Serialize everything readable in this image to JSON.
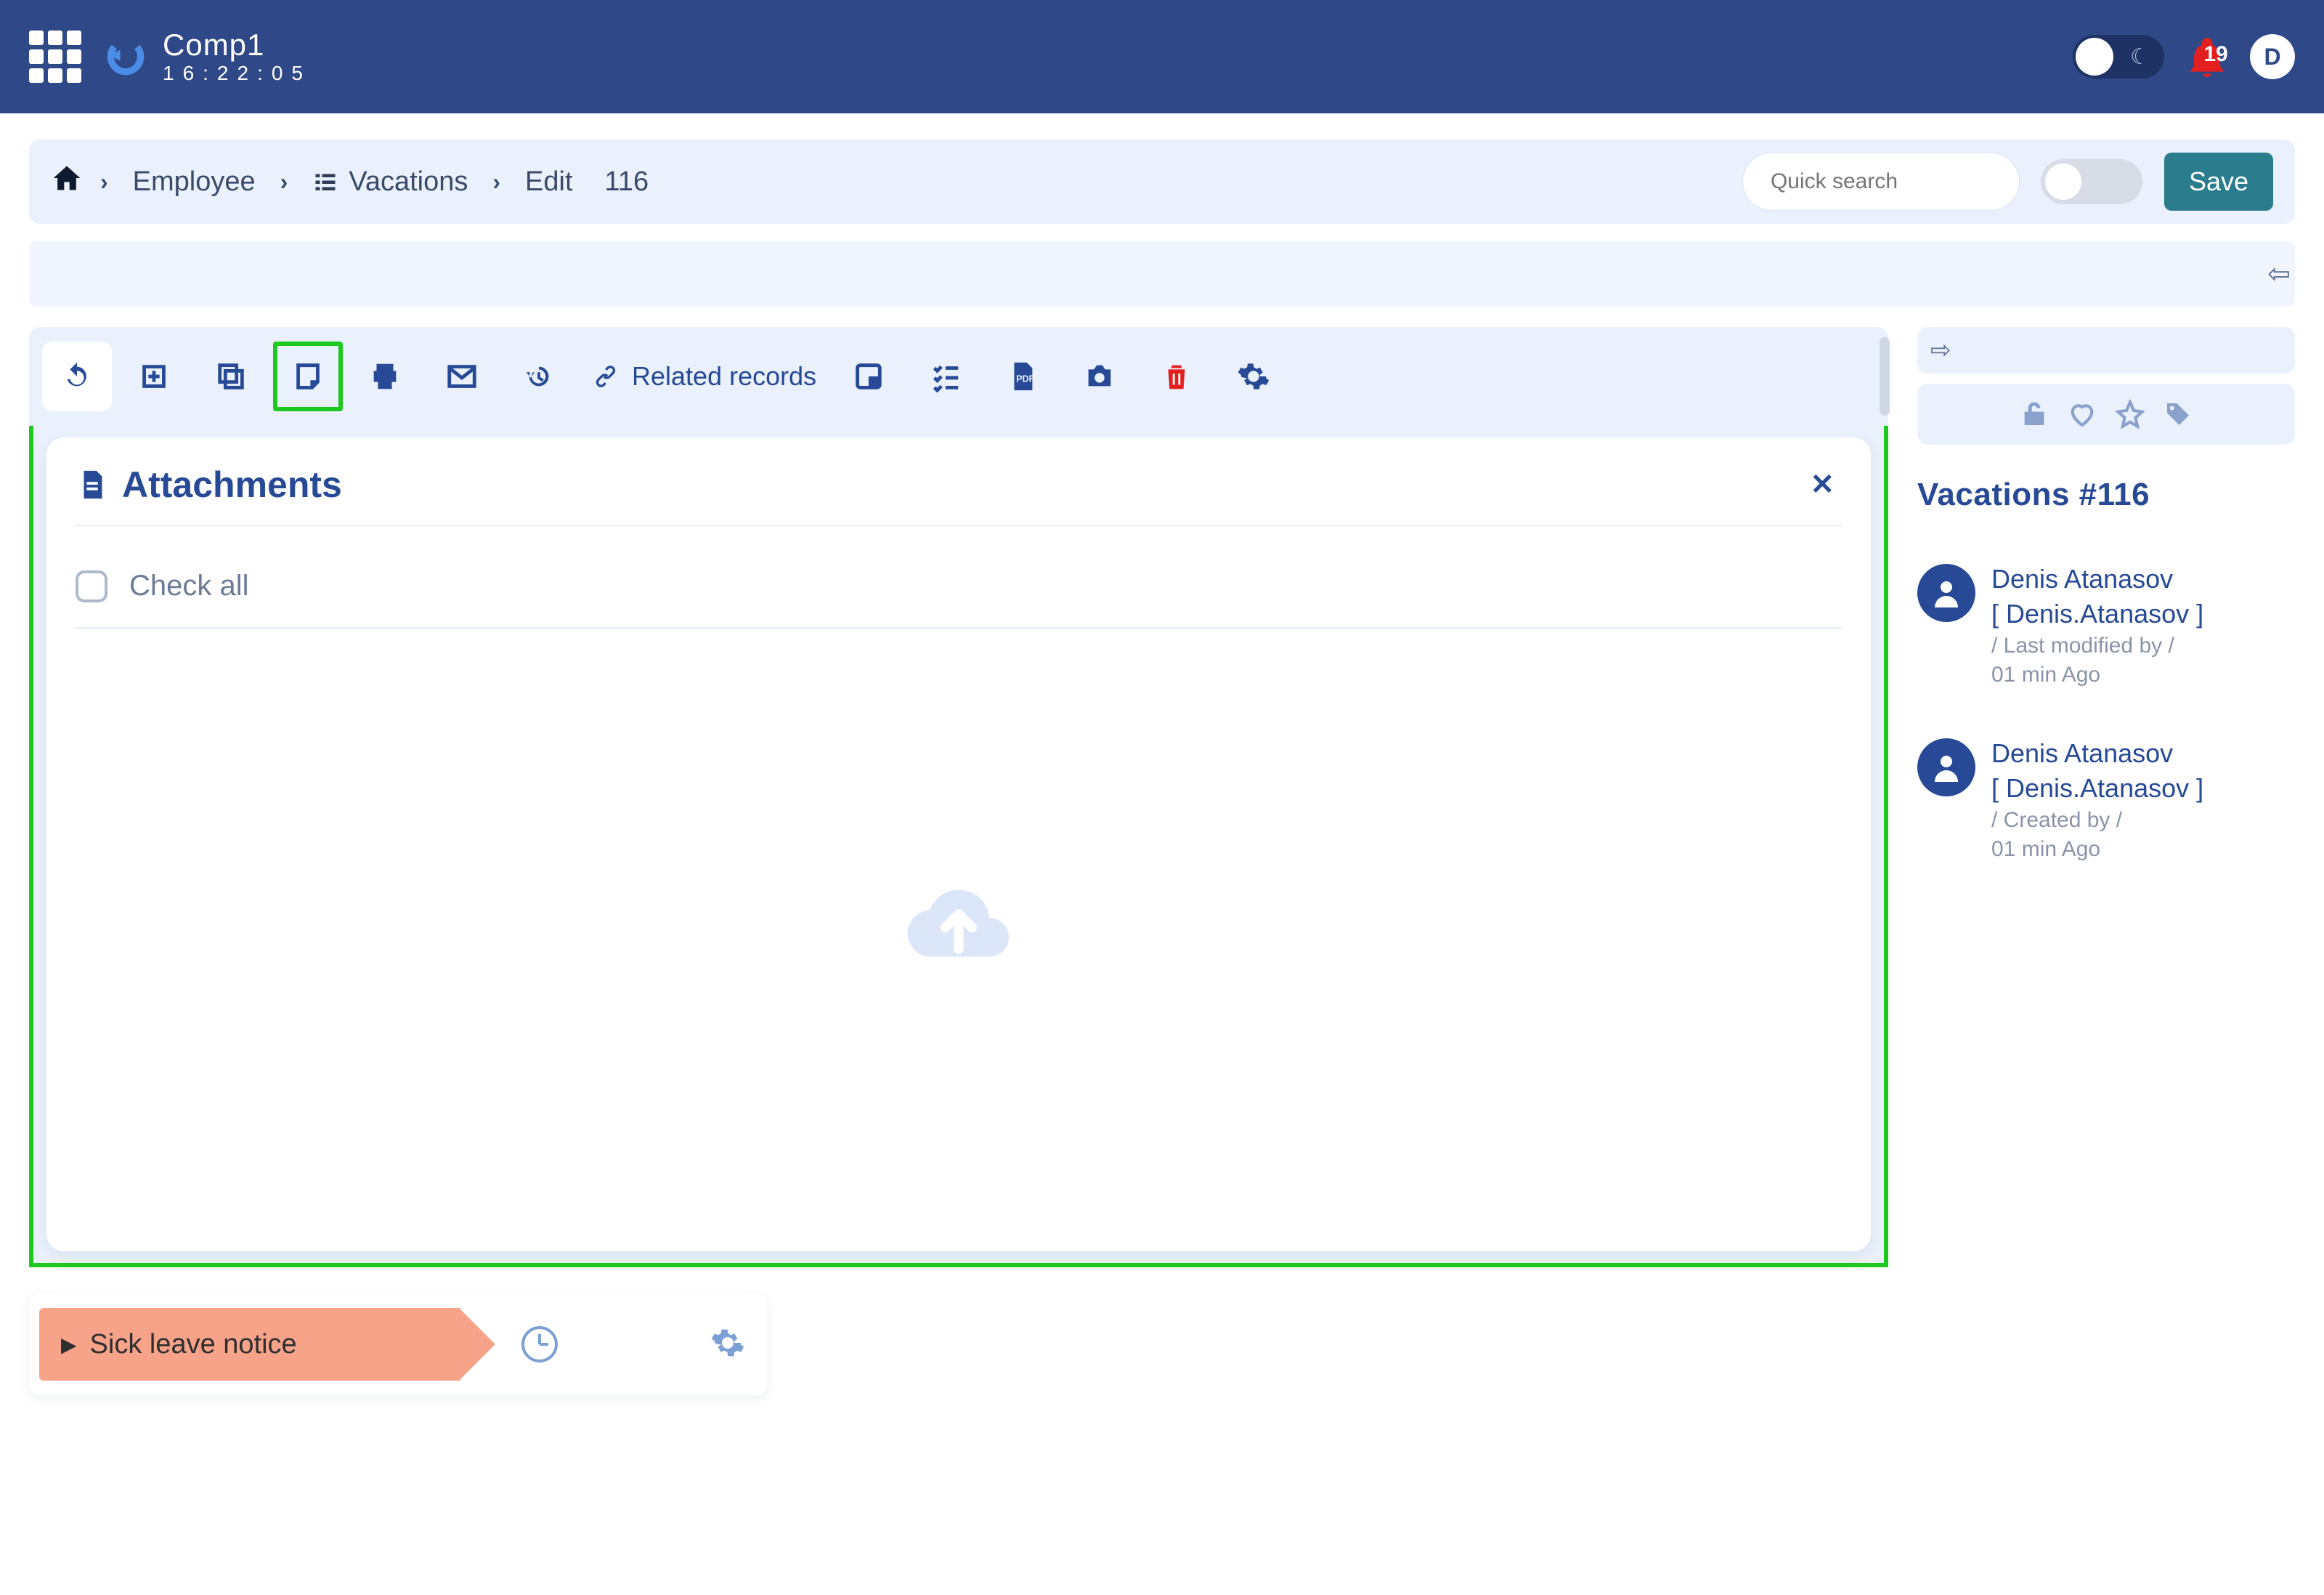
{
  "header": {
    "company": "Comp1",
    "clock": "16:22:05",
    "notification_count": "19",
    "avatar_initial": "D"
  },
  "breadcrumb": {
    "employee": "Employee",
    "vacations": "Vacations",
    "edit": "Edit",
    "record_id": "116",
    "search_placeholder": "Quick search",
    "save_label": "Save"
  },
  "toolbar": {
    "related_label": "Related records"
  },
  "attachments": {
    "title": "Attachments",
    "check_all_label": "Check all"
  },
  "workflow": {
    "chip_label": "Sick leave notice"
  },
  "sidebar": {
    "title": "Vacations #116",
    "modified": {
      "name": "Denis Atanasov",
      "login": "[ Denis.Atanasov ]",
      "label": "/ Last modified by /",
      "ago": "01 min Ago"
    },
    "created": {
      "name": "Denis Atanasov",
      "login": "[ Denis.Atanasov ]",
      "label": "/ Created by /",
      "ago": "01 min Ago"
    }
  }
}
